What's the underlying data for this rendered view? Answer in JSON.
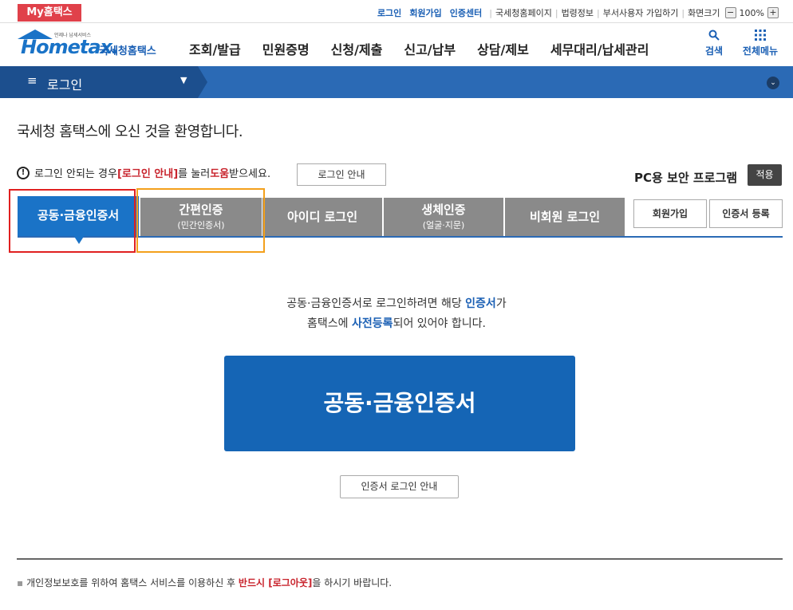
{
  "utility": {
    "my_tab": "My홈택스",
    "login": "로그인",
    "join": "회원가입",
    "cert_center": "인증센터",
    "nts_page": "국세청홈페이지",
    "law": "법령정보",
    "dept_join": "부서사용자 가입하기",
    "screen_size": "화면크기",
    "zoom_minus": "−",
    "zoom_value": "100%",
    "zoom_plus": "+"
  },
  "logo": {
    "small": "언제나 납세서비스",
    "brand": "Hometax.",
    "korean": "국세청홈택스"
  },
  "nav": [
    "조회/발급",
    "민원증명",
    "신청/제출",
    "신고/납부",
    "상담/제보",
    "세무대리/납세관리"
  ],
  "header_right": {
    "search": "검색",
    "all_menu": "전체메뉴"
  },
  "login_bar": {
    "title": "로그인"
  },
  "welcome": "국세청 홈택스에 오신 것을 환영합니다.",
  "help": {
    "prefix": "로그인 안되는 경우 ",
    "link": "[로그인 안내]",
    "mid": "를 눌러 ",
    "help_word": "도움",
    "suffix": "받으세요.",
    "button": "로그인 안내"
  },
  "pc_security": {
    "label": "PC용 보안 프로그램",
    "button": "적용"
  },
  "tabs": [
    {
      "label": "공동·금융인증서",
      "sub": ""
    },
    {
      "label": "간편인증",
      "sub": "(민간인증서)"
    },
    {
      "label": "아이디 로그인",
      "sub": ""
    },
    {
      "label": "생체인증",
      "sub": "(얼굴·지문)"
    },
    {
      "label": "비회원 로그인",
      "sub": ""
    }
  ],
  "side_buttons": {
    "join": "회원가입",
    "cert_register": "인증서 등록"
  },
  "info": {
    "line1_a": "공동·금융인증서로 로그인하려면 해당 ",
    "line1_b": "인증서",
    "line1_c": "가",
    "line2_a": "홈택스에 ",
    "line2_b": "사전등록",
    "line2_c": "되어 있어야 합니다."
  },
  "big_button": "공동·금융인증서",
  "cert_guide_button": "인증서 로그인 안내",
  "footnote": {
    "a": "개인정보보호를 위하여 홈택스 서비스를 이용하신 후 ",
    "b": "반드시 [로그아웃]",
    "c": "을 하시기 바랍니다."
  }
}
